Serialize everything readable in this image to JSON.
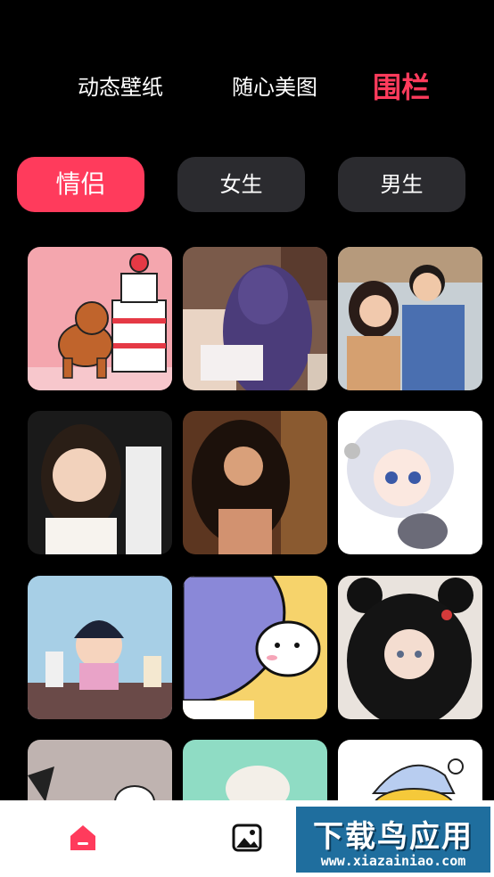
{
  "top_tabs": [
    {
      "label": "动态壁纸",
      "active": false
    },
    {
      "label": "随心美图",
      "active": false
    },
    {
      "label": "围栏",
      "active": true
    }
  ],
  "category_chips": [
    {
      "label": "情侣",
      "active": true
    },
    {
      "label": "女生",
      "active": false
    },
    {
      "label": "男生",
      "active": false
    }
  ],
  "grid_items": [
    {
      "name": "thumb-cartoon-dog-cake"
    },
    {
      "name": "thumb-anime-girl-purple-hair"
    },
    {
      "name": "thumb-couple-photo"
    },
    {
      "name": "thumb-smiling-girl"
    },
    {
      "name": "thumb-woman-dark-portrait"
    },
    {
      "name": "thumb-anime-white-hair-girl"
    },
    {
      "name": "thumb-cartoon-boy"
    },
    {
      "name": "thumb-cartoon-monster-bunny"
    },
    {
      "name": "thumb-anime-girl-mouse-ears"
    },
    {
      "name": "thumb-cartoon-cat"
    },
    {
      "name": "thumb-cartoon-bear"
    },
    {
      "name": "thumb-yellow-character-hat"
    }
  ],
  "bottom_nav": [
    {
      "icon": "home-icon",
      "active": true
    },
    {
      "icon": "image-icon",
      "active": false
    }
  ],
  "watermark": {
    "title": "下载鸟应用",
    "url": "www.xiazainiao.com"
  },
  "colors": {
    "accent": "#ff3b5c",
    "chip_bg": "#2b2b2f",
    "background": "#000000"
  }
}
